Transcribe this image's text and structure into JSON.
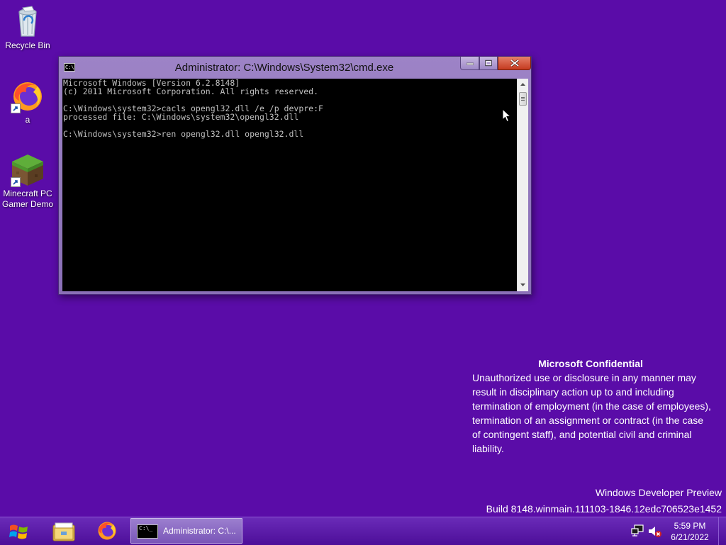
{
  "desktop": {
    "background_color": "#5a0ca8",
    "icons": [
      {
        "label": "Recycle Bin",
        "icon": "recycle-bin-icon"
      },
      {
        "label": "a",
        "icon": "firefox-icon"
      },
      {
        "label": "Minecraft PC Gamer Demo",
        "icon": "minecraft-icon"
      }
    ]
  },
  "cmd_window": {
    "title": "Administrator: C:\\Windows\\System32\\cmd.exe",
    "console_lines": [
      "Microsoft Windows [Version 6.2.8148]",
      "(c) 2011 Microsoft Corporation. All rights reserved.",
      "",
      "C:\\Windows\\system32>cacls opengl32.dll /e /p devpre:F",
      "processed file: C:\\Windows\\system32\\opengl32.dll",
      "",
      "C:\\Windows\\system32>ren opengl32.dll opengl32.dll"
    ],
    "icon_text": "C:\\",
    "buttons": {
      "minimize": "minimize-icon",
      "maximize": "maximize-icon",
      "close": "close-icon"
    }
  },
  "watermark": {
    "title": "Microsoft Confidential",
    "body": "Unauthorized use or disclosure in any manner may result in disciplinary action up to and including termination of employment (in the case of employees), termination of an assignment or contract (in the case of contingent staff), and potential civil and criminal liability.",
    "build_line1": "Windows Developer Preview",
    "build_line2": "Build 8148.winmain.111103-1846.12edc706523e1452"
  },
  "taskbar": {
    "pinned": [
      "file-explorer-icon",
      "firefox-icon"
    ],
    "active_task_label": "Administrator: C:\\...",
    "active_task_icon_text": "C:\\_",
    "clock_time": "5:59 PM",
    "clock_date": "6/21/2022"
  }
}
